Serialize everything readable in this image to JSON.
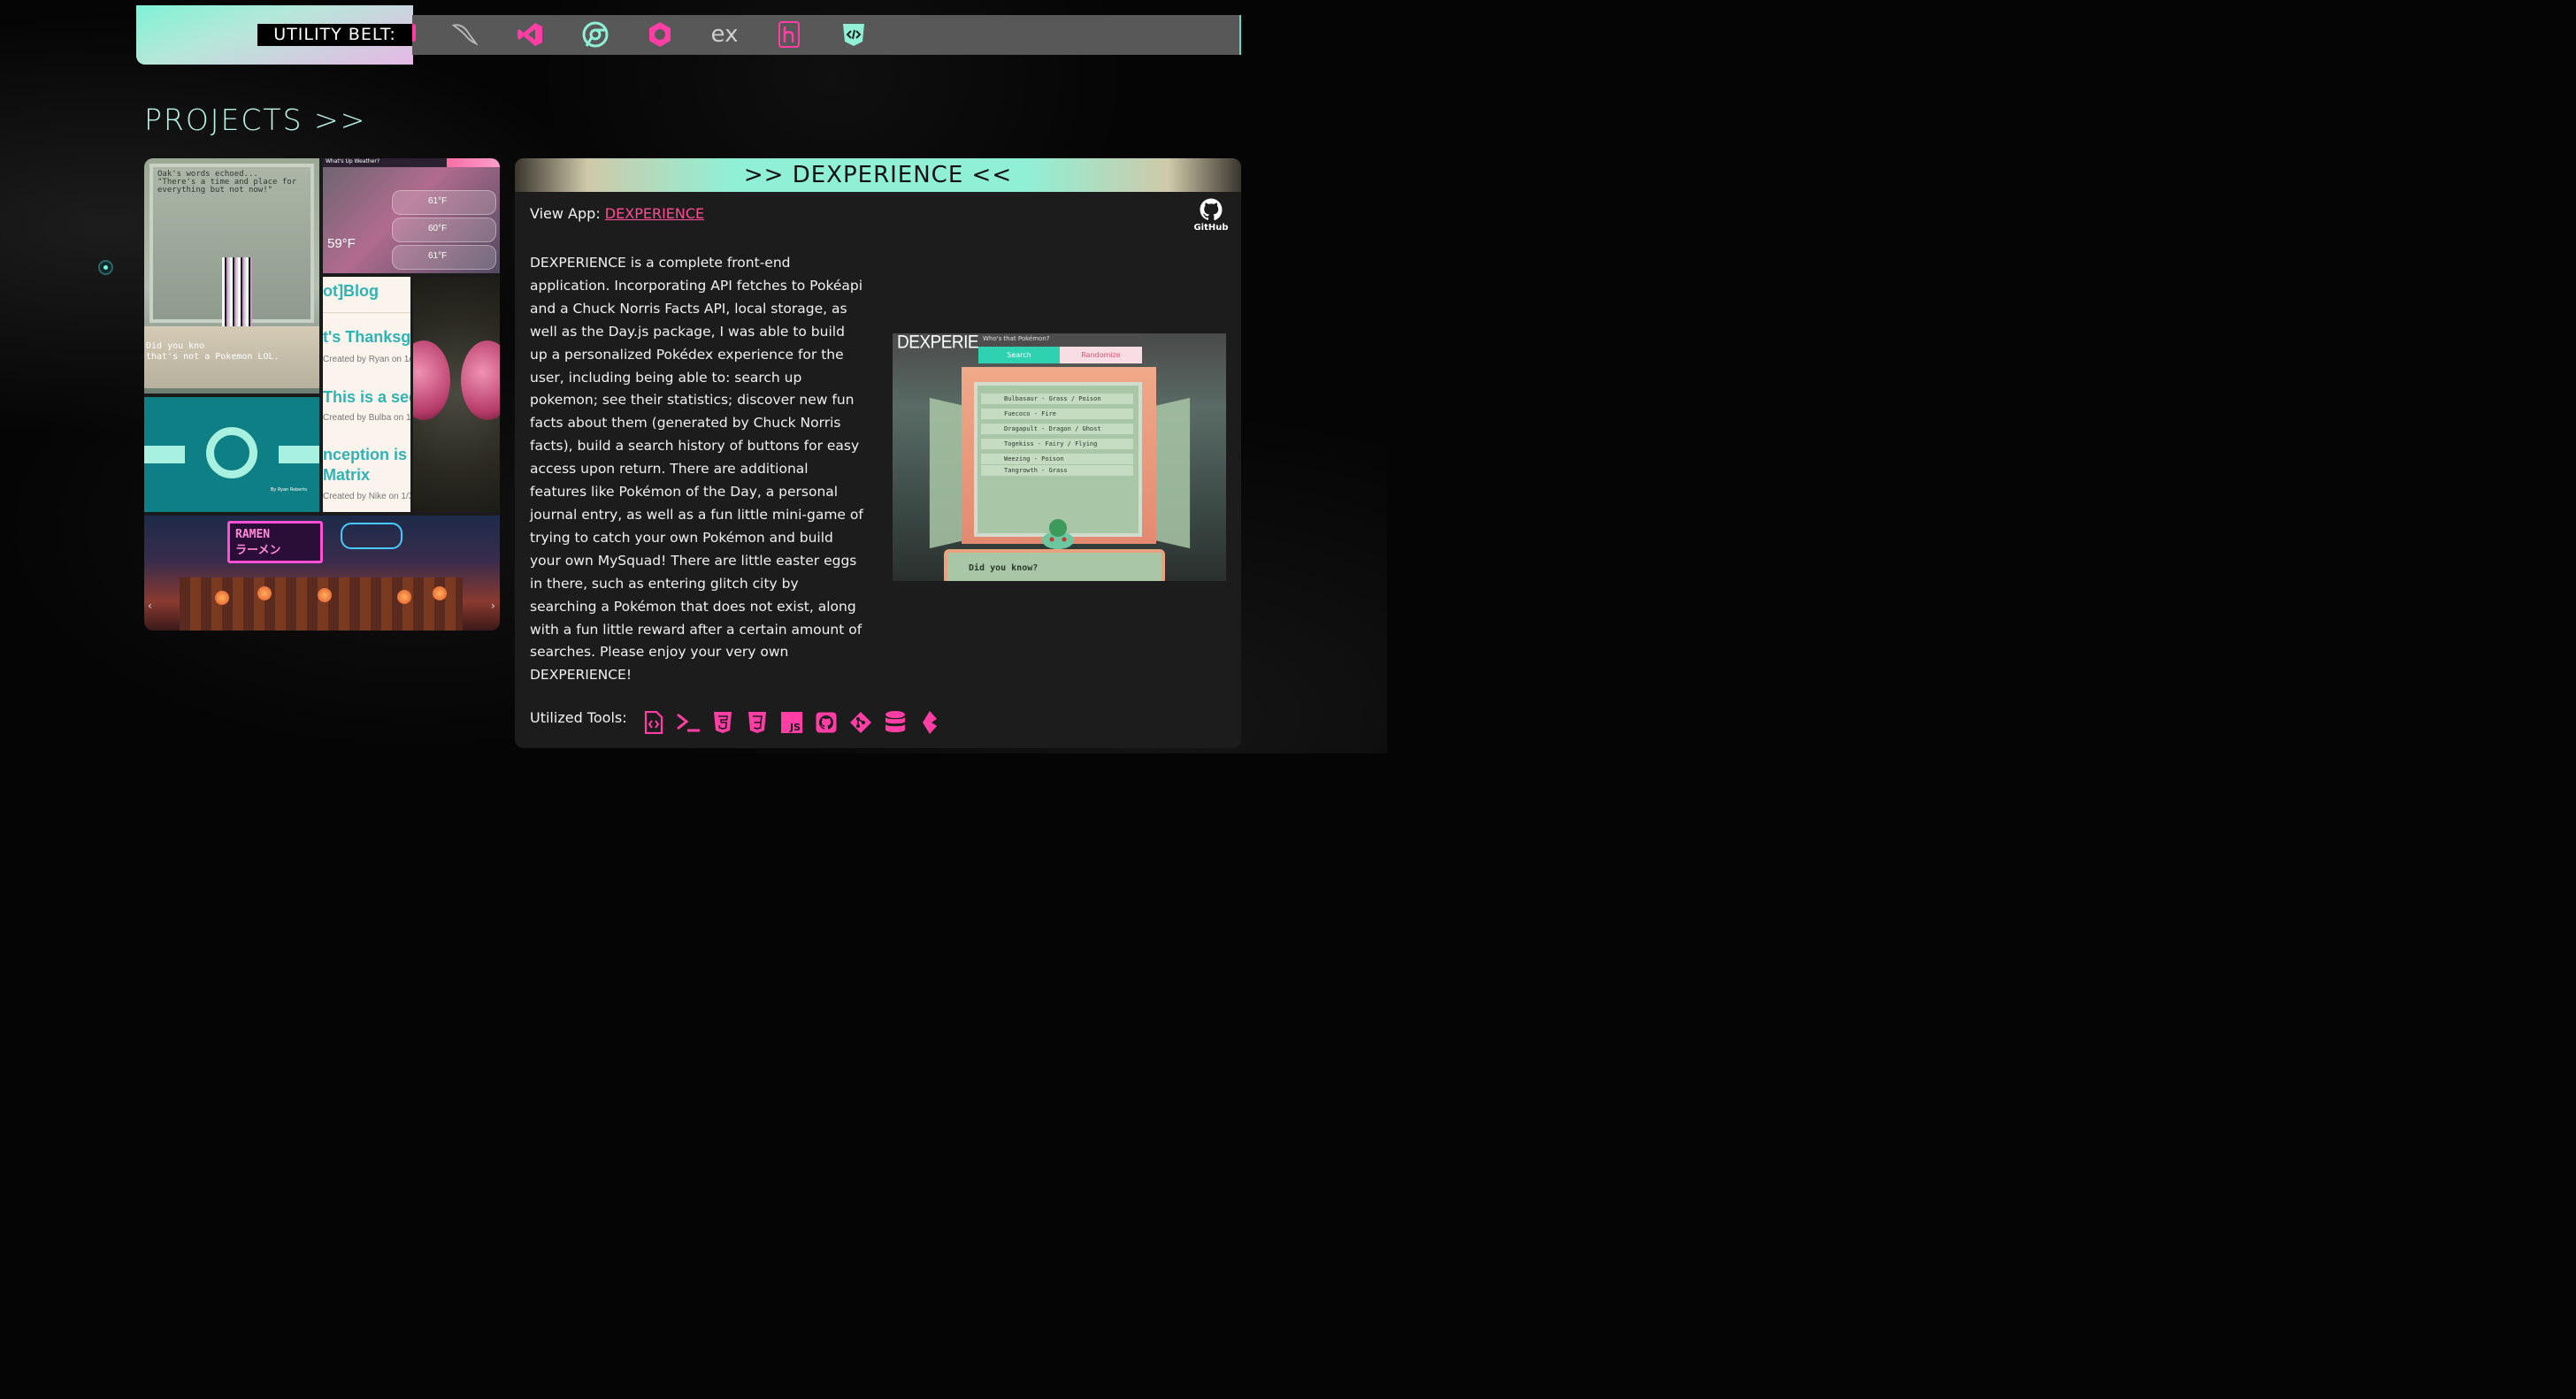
{
  "utility_belt": {
    "label": "UTILITY BELT:",
    "tools": [
      "mysql-icon",
      "vscode-icon",
      "chrome-icon",
      "hexagon-icon",
      "express-icon",
      "heroku-icon",
      "code-shield-icon"
    ],
    "express_text": "ex",
    "tool_color": "#ff3ea5"
  },
  "section": {
    "title": "PROJECTS >>"
  },
  "collage": {
    "pokemon_msg": "Oak's words echoed...\n\"There's a time and place for\neverything but not now!\"",
    "pokemon_band": "Did you kno\nthat's not a Pokemon LOL.",
    "weather_title": "What's Up Weather?",
    "weather_current": "59°F",
    "weather_temps": [
      "61°F",
      "60°F",
      "61°F"
    ],
    "blog_lines": [
      {
        "title": "ot]Blog",
        "sub": ""
      },
      {
        "title": "t's Thanksg",
        "sub": "Created by Ryan on 1/"
      },
      {
        "title": "This is a see",
        "sub": "Created by Bulba on 1"
      },
      {
        "title": "nception is",
        "sub": ""
      },
      {
        "title": "Matrix",
        "sub": "Created by Nike on 1/3"
      }
    ],
    "logo_credit": "By Ryan Roberts",
    "ramen_sign": "RAMEN\nラーメン",
    "prev_arrow": "‹",
    "next_arrow": "›"
  },
  "project": {
    "title": ">> DEXPERIENCE <<",
    "view_app_label": "View App:",
    "view_app_link": "DEXPERIENCE",
    "github_label": "GitHub",
    "description": "DEXPERIENCE is a complete front-end application. Incorporating API fetches to Pokéapi and a Chuck Norris Facts API, local storage, as well as the Day.js package, I was able to build up a personalized Pokédex experience for the user, including being able to: search up pokemon; see their statistics; discover new fun facts about them (generated by Chuck Norris facts), build a search history of buttons for easy access upon return. There are additional features like Pokémon of the Day, a personal journal entry, as well as a fun little mini-game of trying to catch your own Pokémon and build your own MySquad! There are little easter eggs in there, such as entering glitch city by searching a Pokémon that does not exist, along with a fun little reward after a certain amount of searches. Please enjoy your very own DEXPERIENCE!",
    "screenshot": {
      "brand": "DEXPERIENCE",
      "prompt": "Who's that Pokémon?",
      "search_btn": "Search",
      "random_btn": "Randomize",
      "list": [
        "Bulbasaur - Grass / Poison",
        "Fuecoco - Fire",
        "Dragapult - Dragon / Ghost",
        "Togekiss - Fairy / Flying",
        "Weezing - Poison",
        "Tangrowth - Grass"
      ],
      "did_you_know": "Did you know?"
    },
    "tools_label": "Utilized Tools:",
    "tools": [
      "file-code-icon",
      "terminal-icon",
      "html5-icon",
      "css3-icon",
      "javascript-icon",
      "github-icon",
      "git-icon",
      "database-icon",
      "bootstrap-icon"
    ],
    "tool_color": "#ff3ea5"
  },
  "colors": {
    "accent_mint": "#8ff0d6",
    "accent_pink": "#ff4d93",
    "card_bg": "#1c1c1c"
  }
}
